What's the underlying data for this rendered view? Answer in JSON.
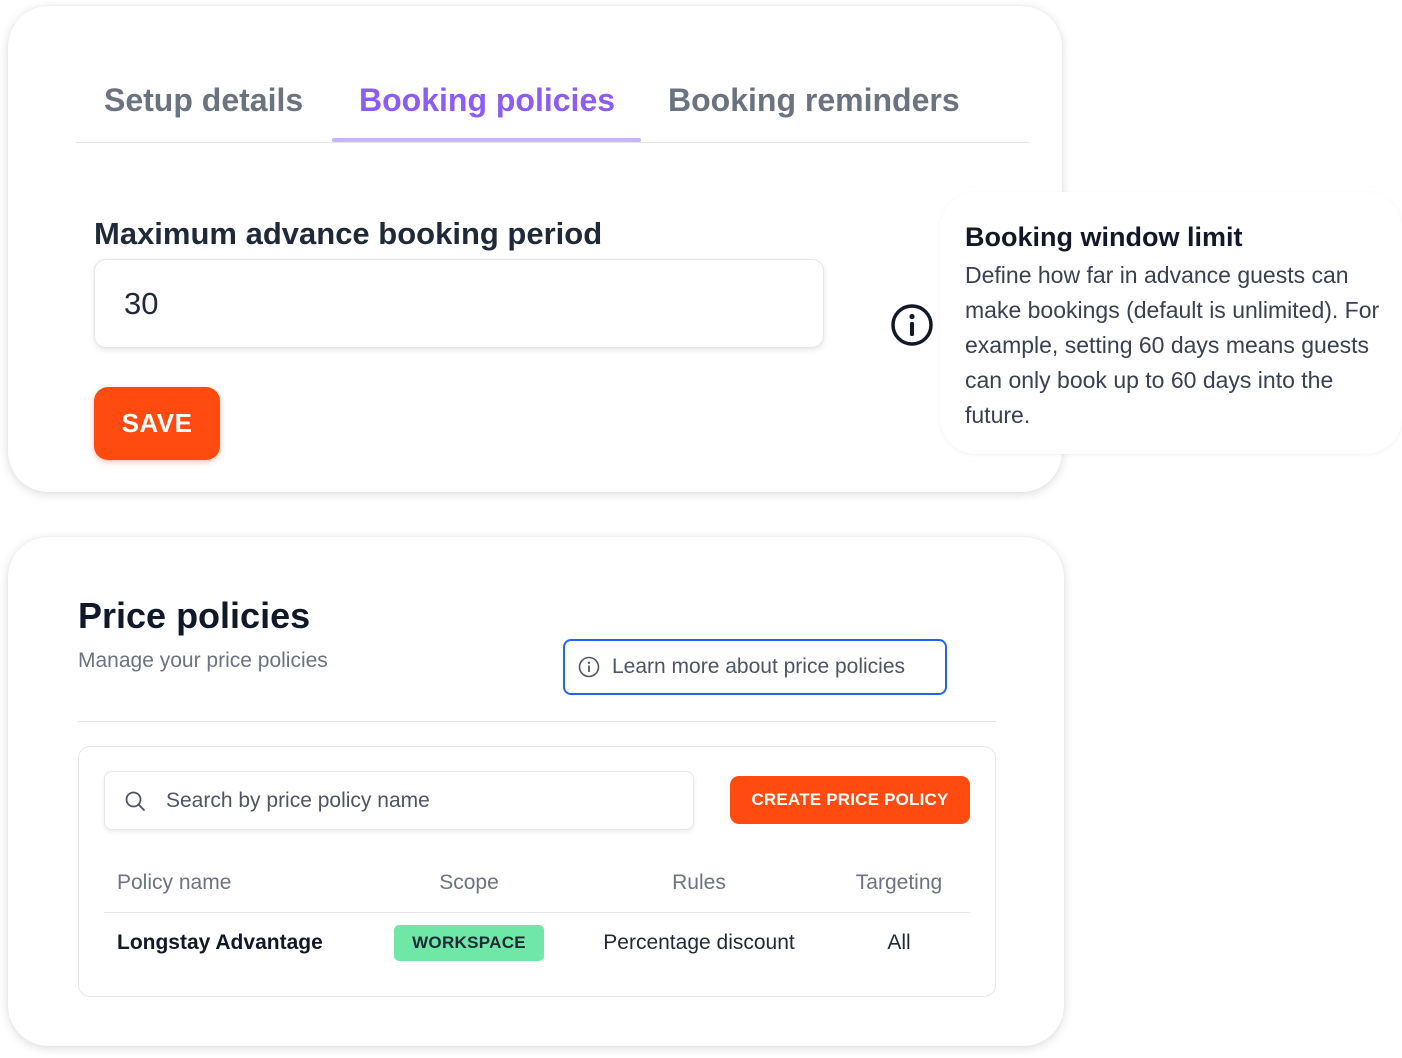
{
  "booking": {
    "tabs": [
      {
        "label": "Setup details",
        "active": false
      },
      {
        "label": "Booking policies",
        "active": true
      },
      {
        "label": "Booking reminders",
        "active": false
      }
    ],
    "field_label": "Maximum advance booking period",
    "field_value": "30",
    "save_label": "SAVE",
    "tooltip": {
      "title": "Booking window limit",
      "body": "Define how far in advance guests can make bookings (default is unlimited). For example, setting 60 days means guests can only book up to 60 days into the future."
    }
  },
  "price_policies": {
    "title": "Price policies",
    "subtitle": "Manage your price policies",
    "learn_more": "Learn more about price policies",
    "search_placeholder": "Search by price policy name",
    "create_label": "CREATE PRICE POLICY",
    "columns": [
      "Policy name",
      "Scope",
      "Rules",
      "Targeting"
    ],
    "rows": [
      {
        "name": "Longstay Advantage",
        "scope": "WORKSPACE",
        "rules": "Percentage discount",
        "targeting": "All"
      }
    ]
  },
  "colors": {
    "accent_purple": "#8b5cf6",
    "primary_orange": "#ff4b10",
    "badge_green": "#6ee7a7",
    "link_border_blue": "#2563eb"
  },
  "icons": [
    "info-circle-icon",
    "search-icon"
  ]
}
